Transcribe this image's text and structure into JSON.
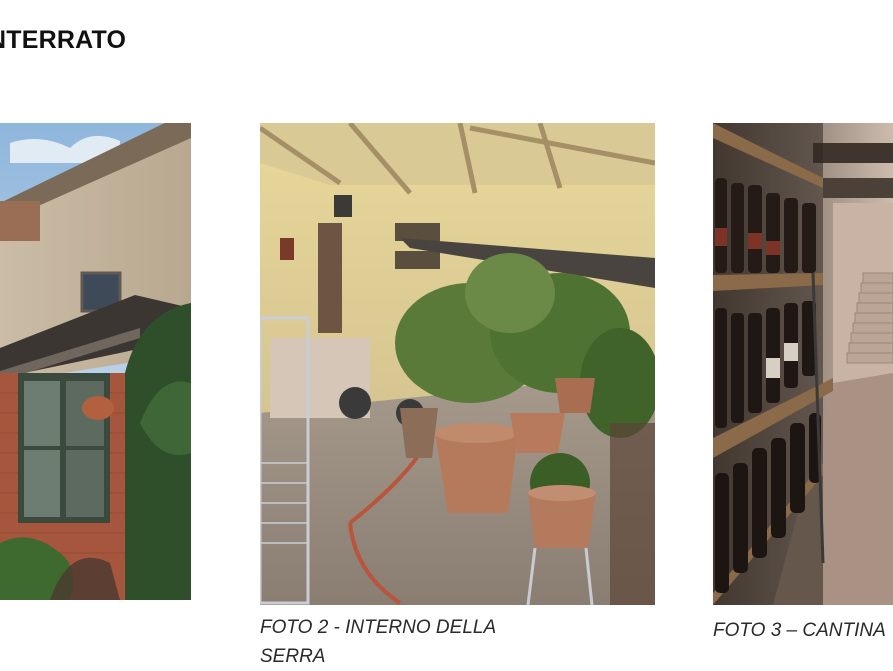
{
  "heading": "NTERRATO",
  "photos": [
    {
      "subject": "brick-annex-exterior-photo"
    },
    {
      "subject": "greenhouse-interior-photo"
    },
    {
      "subject": "wine-cellar-photo"
    }
  ],
  "captions": {
    "foto2_line1": "FOTO 2 - INTERNO DELLA",
    "foto2_line2": "SERRA",
    "foto3": "FOTO 3 – CANTINA"
  }
}
